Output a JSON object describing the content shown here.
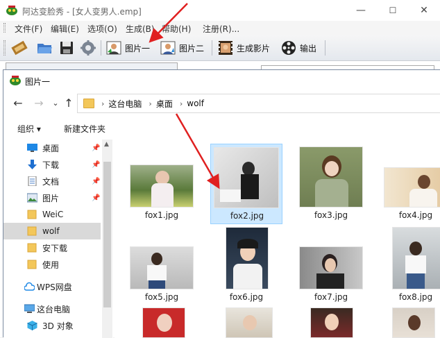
{
  "app": {
    "title": "阿达变脸秀 - [女人变男人.emp]",
    "window_controls": {
      "minimize": "—",
      "maximize": "☐",
      "close": "✕"
    },
    "menu": [
      "文件(F)",
      "编辑(E)",
      "选项(O)",
      "生成(B)",
      "帮助(H)",
      "注册(R)..."
    ],
    "toolbar": {
      "image1_label": "图片一",
      "image2_label": "图片二",
      "generate_label": "生成影片",
      "export_label": "输出"
    }
  },
  "dialog": {
    "title": "图片一",
    "breadcrumb": [
      "这台电脑",
      "桌面",
      "wolf"
    ],
    "commands": {
      "organize": "组织 ▾",
      "new_folder": "新建文件夹"
    },
    "nav_items": [
      {
        "label": "桌面",
        "icon": "desktop-icon",
        "pinned": true
      },
      {
        "label": "下载",
        "icon": "download-icon",
        "pinned": true
      },
      {
        "label": "文档",
        "icon": "document-icon",
        "pinned": true
      },
      {
        "label": "图片",
        "icon": "pictures-icon",
        "pinned": true
      },
      {
        "label": "WeiC",
        "icon": "folder-icon",
        "pinned": false
      },
      {
        "label": "wolf",
        "icon": "folder-icon",
        "pinned": false,
        "selected": true
      },
      {
        "label": "安下载",
        "icon": "folder-icon",
        "pinned": false
      },
      {
        "label": "使用",
        "icon": "folder-icon",
        "pinned": false
      },
      {
        "label": "WPS网盘",
        "icon": "cloud-icon",
        "pinned": false
      },
      {
        "label": "这台电脑",
        "icon": "computer-icon",
        "pinned": false
      },
      {
        "label": "3D 对象",
        "icon": "3d-objects-icon",
        "pinned": false
      }
    ],
    "files": [
      {
        "name": "fox1.jpg",
        "selected": false
      },
      {
        "name": "fox2.jpg",
        "selected": true
      },
      {
        "name": "fox3.jpg",
        "selected": false
      },
      {
        "name": "fox4.jpg",
        "selected": false
      },
      {
        "name": "fox5.jpg",
        "selected": false
      },
      {
        "name": "fox6.jpg",
        "selected": false
      },
      {
        "name": "fox7.jpg",
        "selected": false
      },
      {
        "name": "fox8.jpg",
        "selected": false
      }
    ]
  },
  "colors": {
    "annotation_arrow": "#e02020",
    "selection_bg": "#cce8ff",
    "selection_border": "#99d1ff",
    "nav_selected_bg": "#d9d9d9"
  }
}
